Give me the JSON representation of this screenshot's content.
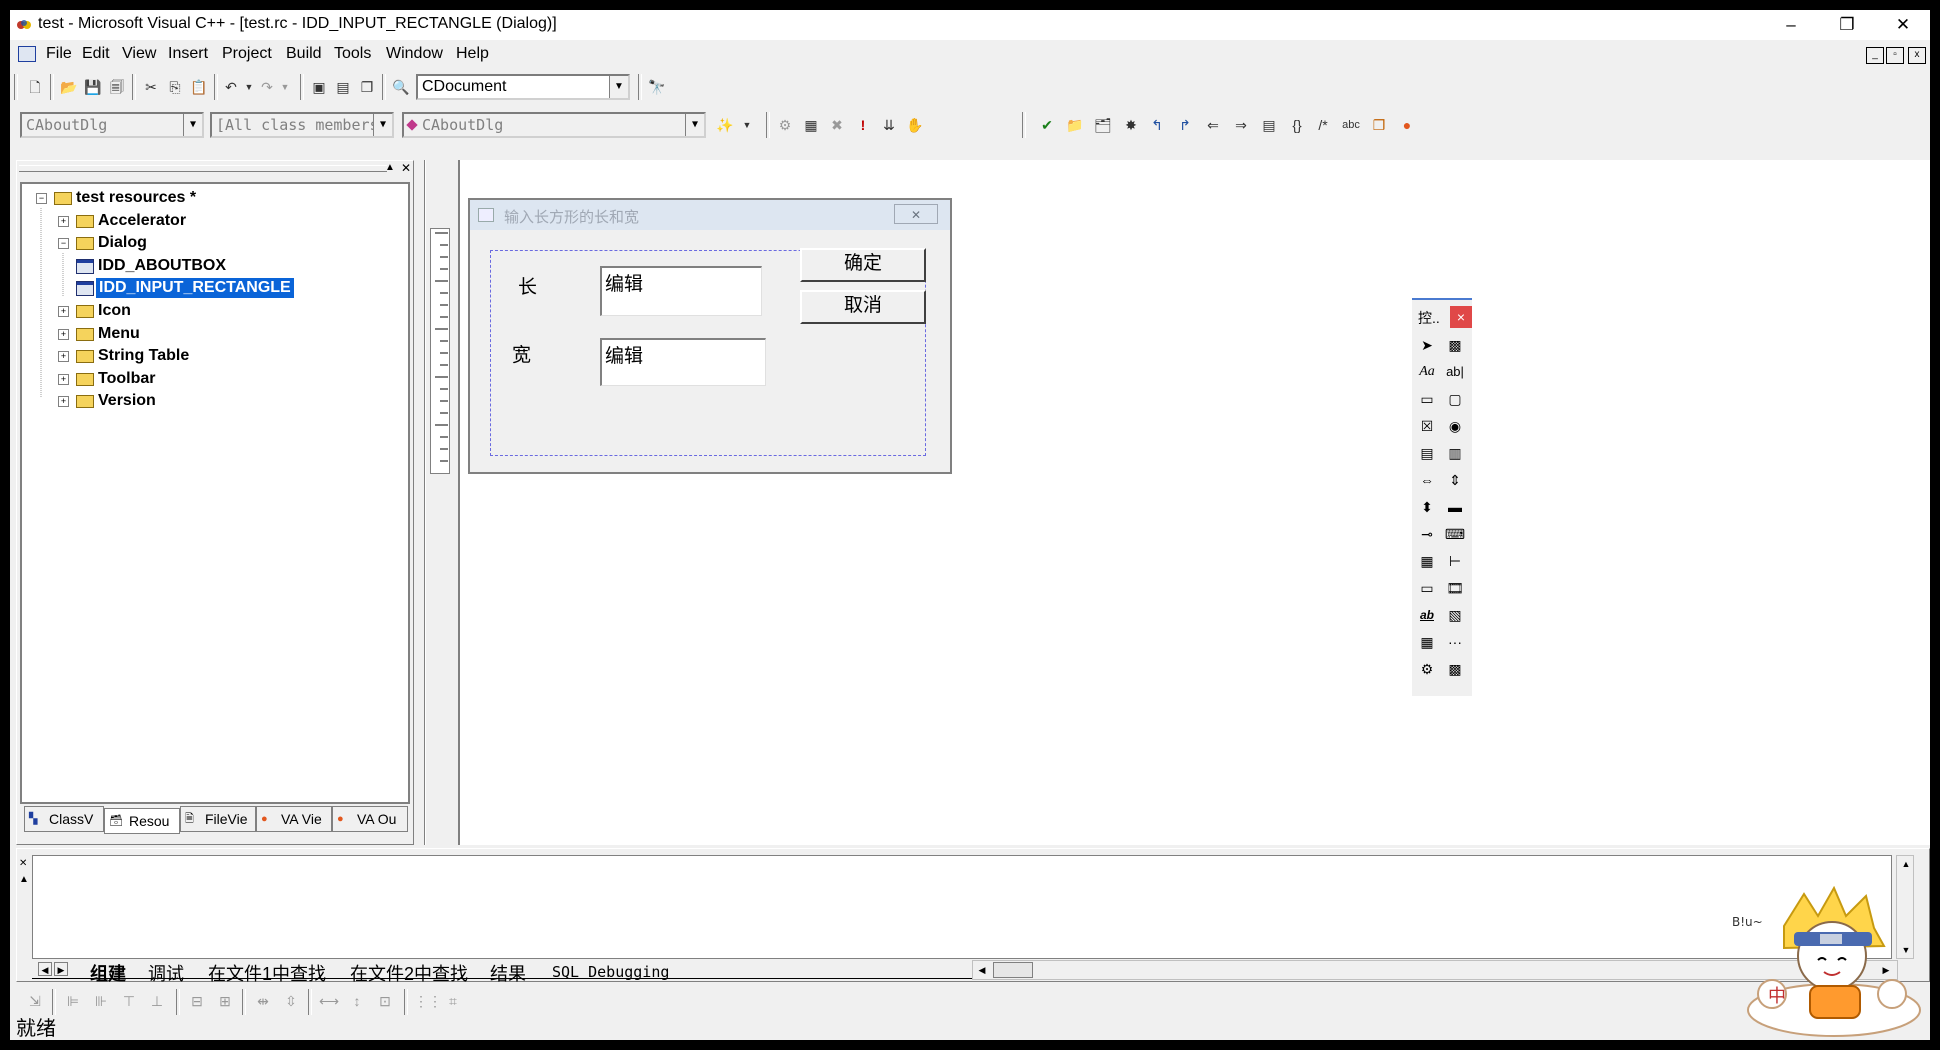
{
  "window": {
    "title": "test - Microsoft Visual C++ - [test.rc - IDD_INPUT_RECTANGLE (Dialog)]",
    "minimize": "–",
    "restore": "❐",
    "close": "✕"
  },
  "menu": {
    "items": [
      "File",
      "Edit",
      "View",
      "Insert",
      "Project",
      "Build",
      "Tools",
      "Window",
      "Help"
    ],
    "mdi_min": "_",
    "mdi_restore": "▫",
    "mdi_close": "x"
  },
  "toolbar": {
    "find_combo": "CDocument",
    "class_combo": "CAboutDlg",
    "filter_combo": "[All class members]",
    "member_combo": "CAboutDlg"
  },
  "workspace": {
    "tree": [
      {
        "label": "test resources *",
        "level": 0,
        "expander": "−",
        "icon": "folder-open"
      },
      {
        "label": "Accelerator",
        "level": 1,
        "expander": "+",
        "icon": "folder"
      },
      {
        "label": "Dialog",
        "level": 1,
        "expander": "−",
        "icon": "folder-open"
      },
      {
        "label": "IDD_ABOUTBOX",
        "level": 2,
        "expander": "",
        "icon": "dialog"
      },
      {
        "label": "IDD_INPUT_RECTANGLE",
        "level": 2,
        "expander": "",
        "icon": "dialog",
        "selected": true
      },
      {
        "label": "Icon",
        "level": 1,
        "expander": "+",
        "icon": "folder"
      },
      {
        "label": "Menu",
        "level": 1,
        "expander": "+",
        "icon": "folder"
      },
      {
        "label": "String Table",
        "level": 1,
        "expander": "+",
        "icon": "folder"
      },
      {
        "label": "Toolbar",
        "level": 1,
        "expander": "+",
        "icon": "folder"
      },
      {
        "label": "Version",
        "level": 1,
        "expander": "+",
        "icon": "folder"
      }
    ],
    "tabs": [
      "ClassV",
      "Resou",
      "FileVie",
      "VA Vie",
      "VA Ou"
    ]
  },
  "dialog": {
    "title": "输入长方形的长和宽",
    "label_length": "长",
    "label_width": "宽",
    "edit1": "编辑",
    "edit2": "编辑",
    "ok": "确定",
    "cancel": "取消"
  },
  "palette": {
    "title": "控..",
    "close": "×"
  },
  "output": {
    "tabs": [
      "组建",
      "调试",
      "在文件1中查找",
      "在文件2中查找",
      "结果",
      "SQL Debugging"
    ]
  },
  "status": {
    "text": "就绪",
    "ime": "中"
  },
  "colors": {
    "selection": "#0a64d8",
    "window_bg": "#f0f0f0",
    "dialog_caption": "#dde6f1"
  }
}
